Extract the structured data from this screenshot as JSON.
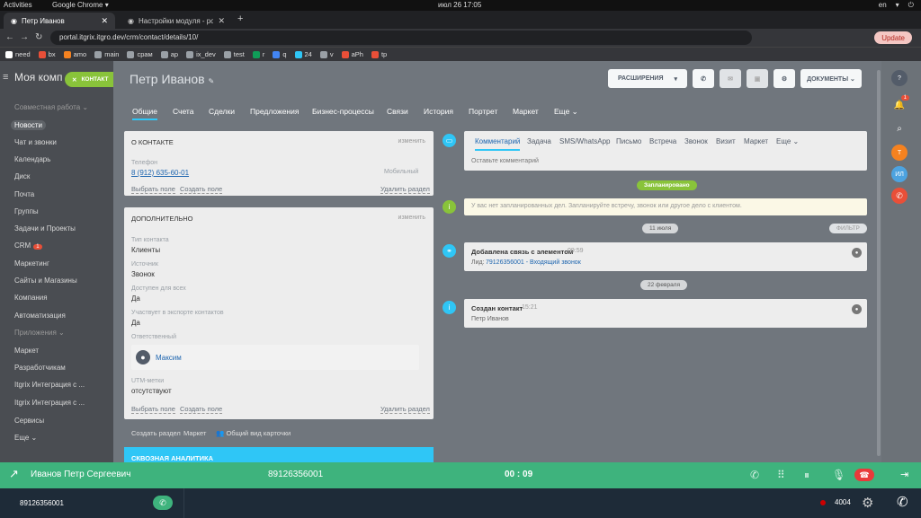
{
  "os": {
    "activities": "Activities",
    "app": "Google Chrome ▾",
    "clock": "июл 26  17:05",
    "lang": "en"
  },
  "browser": {
    "tabs": [
      {
        "title": "Петр Иванов"
      },
      {
        "title": "Настройки модуля - port"
      }
    ],
    "url": "portal.itgrix.itgro.dev/crm/contact/details/10/",
    "update_label": "Update",
    "bookmarks": [
      "need",
      "bx",
      "amo",
      "main",
      "cpам",
      "ap",
      "ix_dev",
      "test",
      "r",
      "q",
      "24",
      "v",
      "aPh",
      "tp"
    ]
  },
  "sidebar": {
    "brand": "Моя комп",
    "kontakt_label": "КОНТАКТ",
    "items": [
      {
        "label": "Совместная работа ⌄",
        "head": true
      },
      {
        "label": "Новости",
        "current": true
      },
      {
        "label": "Чат и звонки"
      },
      {
        "label": "Календарь"
      },
      {
        "label": "Диск"
      },
      {
        "label": "Почта"
      },
      {
        "label": "Группы"
      },
      {
        "label": "Задачи и Проекты"
      },
      {
        "label": "CRM",
        "badge": "1"
      },
      {
        "label": "Маркетинг"
      },
      {
        "label": "Сайты и Магазины"
      },
      {
        "label": "Компания"
      },
      {
        "label": "Автоматизация"
      },
      {
        "label": "Приложения ⌄",
        "head": true
      },
      {
        "label": "Маркет"
      },
      {
        "label": "Разработчикам"
      },
      {
        "label": "Itgrix Интеграция с ..."
      },
      {
        "label": "Itgrix Интеграция с ..."
      },
      {
        "label": "Сервисы"
      },
      {
        "label": "Еще ⌄"
      }
    ]
  },
  "header": {
    "title": "Петр  Иванов",
    "extensions_label": "РАСШИРЕНИЯ",
    "documents_label": "ДОКУМЕНТЫ ⌄"
  },
  "tabs": [
    "Общие",
    "Счета",
    "Сделки",
    "Предложения",
    "Бизнес-процессы",
    "Связи",
    "История",
    "Портрет",
    "Маркет",
    "Еще ⌄"
  ],
  "about": {
    "title": "О контакте",
    "edit": "изменить",
    "phone_label": "Телефон",
    "phone": "8 (912) 635-60-01",
    "phone_type": "Мобильный",
    "choose_field": "Выбрать поле",
    "create_field": "Создать поле",
    "delete_section": "Удалить раздел"
  },
  "extra": {
    "title": "Дополнительно",
    "edit": "изменить",
    "type_label": "Тип контакта",
    "type": "Клиенты",
    "source_label": "Источник",
    "source": "Звонок",
    "available_label": "Доступен для всех",
    "available": "Да",
    "export_label": "Участвует в экспорте контактов",
    "export": "Да",
    "responsible_label": "Ответственный",
    "responsible": "Максим",
    "utm_label": "UTM-метки",
    "utm": "отсутствуют",
    "choose_field": "Выбрать поле",
    "create_field": "Создать поле",
    "delete_section": "Удалить раздел"
  },
  "footer_links": {
    "create_section": "Создать раздел",
    "market": "Маркет",
    "view": "Общий вид карточки"
  },
  "analytics_label": "СКВОЗНАЯ АНАЛИТИКА",
  "composer": {
    "tabs": [
      "Комментарий",
      "Задача",
      "SMS/WhatsApp",
      "Письмо",
      "Встреча",
      "Звонок",
      "Визит",
      "Маркет",
      "Еще ⌄"
    ],
    "placeholder": "Оставьте комментарий"
  },
  "timeline": {
    "planned_pill": "Запланировано",
    "planned_text": "У вас нет запланированных дел. Запланируйте встречу, звонок или другое дело с клиентом.",
    "date1": "11 июля",
    "filter": "ФИЛЬТР",
    "event1_title": "Добавлена связь с элементом",
    "event1_time": "09:59",
    "event1_prefix": "Лид:",
    "event1_link": "79126356001 - Входящий звонок",
    "date2": "22 февраля",
    "event2_title": "Создан контакт",
    "event2_time": "15:21",
    "event2_body": "Петр Иванов"
  },
  "callbar": {
    "name": "Иванов Петр Сергеевич",
    "number": "89126356001",
    "timer": "00 : 09"
  },
  "bottombar": {
    "number": "89126356001",
    "ext": "4004"
  },
  "rightrail": {
    "t": "Т",
    "il": "ИЛ",
    "notif": "1"
  },
  "colors": {
    "accent": "#2fc6f6",
    "green": "#3eb37d",
    "lime": "#89c33a",
    "danger": "#e93a3a"
  }
}
